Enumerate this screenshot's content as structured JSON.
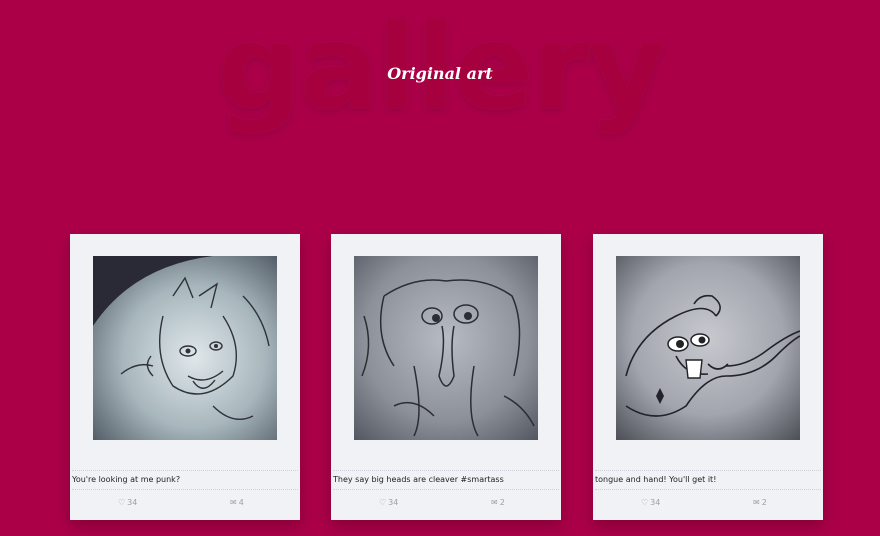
{
  "header": {
    "title": "gallery",
    "subtitle": "Original art"
  },
  "cards": [
    {
      "caption": "You're looking at me punk?",
      "likes": "34",
      "comments": "4",
      "like_icon": "heart-icon",
      "comment_icon": "comment-icon"
    },
    {
      "caption": "They say big heads are cleaver #smartass",
      "likes": "34",
      "comments": "2",
      "like_icon": "heart-icon",
      "comment_icon": "comment-icon"
    },
    {
      "caption": "tongue and hand! You'll get it!",
      "likes": "34",
      "comments": "2",
      "like_icon": "heart-icon",
      "comment_icon": "comment-icon"
    }
  ],
  "colors": {
    "background": "#ab0048",
    "card": "#f1f2f6"
  }
}
